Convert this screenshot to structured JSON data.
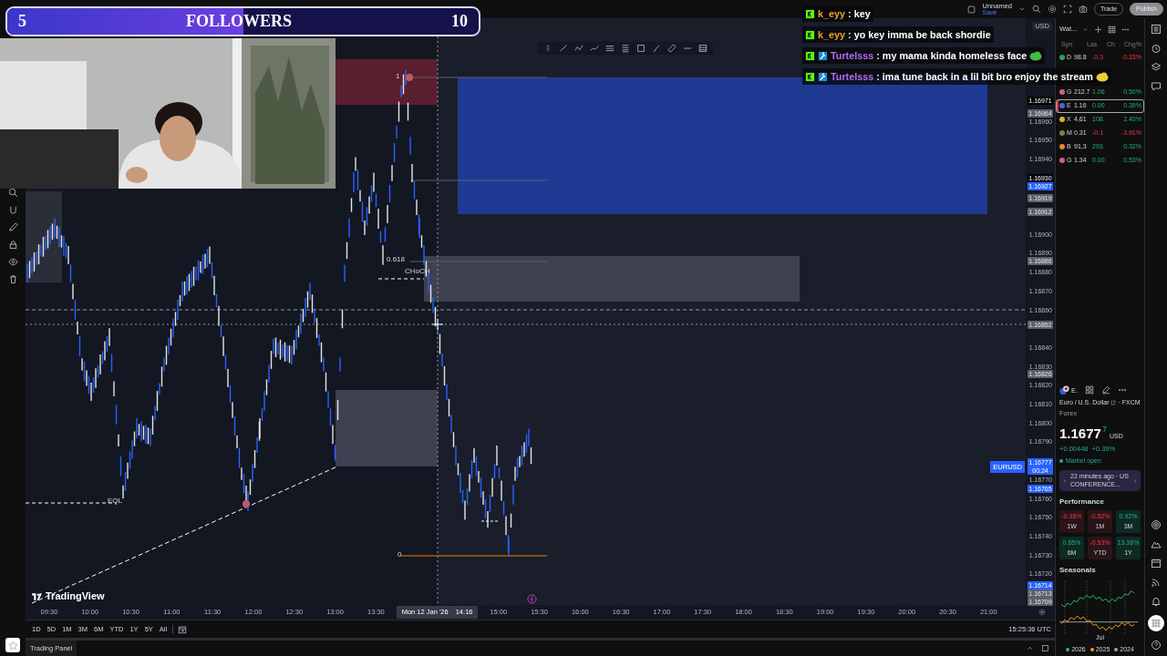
{
  "stream_overlay": {
    "followers": {
      "current": "5",
      "label": "FOLLOWERS",
      "goal": "10",
      "level": 0.5
    },
    "chat": [
      {
        "badges": [
          {
            "kind": "kick"
          }
        ],
        "user": "k_eyy",
        "color": "#f0a030",
        "message": ": key"
      },
      {
        "badges": [
          {
            "kind": "kick"
          }
        ],
        "user": "k_eyy",
        "color": "#f0a030",
        "message": ": yo key imma be back shordie"
      },
      {
        "badges": [
          {
            "kind": "kick"
          },
          {
            "kind": "hammer"
          }
        ],
        "user": "Turtelsss",
        "color": "#b36cf0",
        "message": ": my mama kinda homeless face",
        "emote": {
          "color": "#3fbf3f"
        }
      },
      {
        "badges": [
          {
            "kind": "kick"
          },
          {
            "kind": "hammer"
          }
        ],
        "user": "Turtelsss",
        "color": "#b36cf0",
        "message": ": ima tune back in a lil bit bro enjoy the stream",
        "emote": {
          "color": "#e8d030"
        }
      }
    ]
  },
  "top_bar": {
    "layout_name": "Unnamed",
    "layout_status": "Save",
    "trade": "Trade",
    "publish": "Publish"
  },
  "chart": {
    "symbol_tag": "EURUSD",
    "logo": "TradingView",
    "labels": [
      "1",
      "0.618",
      "CHoCH",
      "0",
      "EQL"
    ],
    "price_axis": {
      "currency": "USD",
      "ticks": [
        "1.16960",
        "1.16950",
        "1.16940",
        "1.16900",
        "1.16890",
        "1.16880",
        "1.16870",
        "1.16860",
        "1.16840",
        "1.16830",
        "1.16820",
        "1.16810",
        "1.16800",
        "1.16790",
        "1.16770",
        "1.16760",
        "1.16750",
        "1.16740",
        "1.16730",
        "1.16720"
      ],
      "tags": [
        {
          "value": "1.16971",
          "kind": "dark"
        },
        {
          "value": "1.16964",
          "kind": "gray"
        },
        {
          "value": "1.16930",
          "kind": "dark"
        },
        {
          "value": "1.16927",
          "kind": "blue"
        },
        {
          "value": "1.16919",
          "kind": "gray"
        },
        {
          "value": "1.16912",
          "kind": "gray"
        },
        {
          "value": "1.16886",
          "kind": "gray"
        },
        {
          "value": "1.16852",
          "kind": "gray"
        },
        {
          "value": "1.16826",
          "kind": "gray"
        },
        {
          "value": "1.16777",
          "kind": "blue",
          "countdown": "00:24"
        },
        {
          "value": "1.16765",
          "kind": "blue"
        },
        {
          "value": "1.16714",
          "kind": "blue"
        },
        {
          "value": "1.16713",
          "kind": "gray"
        },
        {
          "value": "1.16709",
          "kind": "gray"
        }
      ]
    },
    "time_axis": [
      {
        "label": "09:30"
      },
      {
        "label": "10:00"
      },
      {
        "label": "10:30"
      },
      {
        "label": "11:00"
      },
      {
        "label": "11:30"
      },
      {
        "label": "12:00"
      },
      {
        "label": "12:30"
      },
      {
        "label": "13:00"
      },
      {
        "label": "13:30"
      },
      {
        "kind": "crosshair",
        "label": "Mon 12 Jan '26",
        "time": "14:16"
      },
      {
        "label": "15:00"
      },
      {
        "label": "15:30"
      },
      {
        "label": "16:00"
      },
      {
        "label": "16:30"
      },
      {
        "label": "17:00"
      },
      {
        "label": "17:30"
      },
      {
        "label": "18:00"
      },
      {
        "label": "18:30"
      },
      {
        "label": "19:00"
      },
      {
        "label": "19:30"
      },
      {
        "label": "20:00"
      },
      {
        "label": "20:30"
      },
      {
        "label": "21:00"
      }
    ]
  },
  "range_buttons": [
    "1D",
    "5D",
    "1M",
    "3M",
    "6M",
    "YTD",
    "1Y",
    "5Y",
    "All"
  ],
  "clock": "15:25:36 UTC",
  "trading_panel": "Trading Panel",
  "watchlist": {
    "title": "Wat...",
    "columns": [
      "Syn",
      "Las",
      "Ch",
      "Chg%"
    ],
    "rows": [
      {
        "symbol": "D",
        "last": "98.8",
        "change": "-0.3",
        "change_pct": "-0.33%",
        "negative": true,
        "color": "#2e9e5b",
        "selected": false
      },
      {
        "symbol": "G",
        "last": "212.7",
        "change": "1.06",
        "change_pct": "0.50%",
        "negative": false,
        "color": "#d0607a",
        "selected": false
      },
      {
        "symbol": "E",
        "last": "1.16",
        "change": "0.00",
        "change_pct": "0.39%",
        "negative": false,
        "color": "#3a6fd8",
        "selected": true
      },
      {
        "symbol": "X",
        "last": "4,61",
        "change": "108.",
        "change_pct": "2.40%",
        "negative": false,
        "color": "#e0b030",
        "selected": false
      },
      {
        "symbol": "M",
        "last": "0.31",
        "change": "-0.1",
        "change_pct": "-3.91%",
        "negative": true,
        "color": "#8a7a3a",
        "selected": false
      },
      {
        "symbol": "B",
        "last": "91,3",
        "change": "293.",
        "change_pct": "0.32%",
        "negative": false,
        "color": "#e08a30",
        "selected": false
      },
      {
        "symbol": "G",
        "last": "1.34",
        "change": "0.00",
        "change_pct": "0.53%",
        "negative": false,
        "color": "#d06080",
        "selected": false
      }
    ]
  },
  "quote": {
    "symbol": "E.",
    "name": "Euro / U.S. Dollar",
    "exchange": "· FXCM",
    "type": "Forex",
    "price": "1.1677",
    "price_last_digit": "7",
    "currency": "USD",
    "change": "+0.00448",
    "change_pct": "+0.39%",
    "status": "Market open",
    "news": "22 minutes ago · US CONFERENCE...",
    "performance_title": "Performance",
    "performance": [
      {
        "value": "-0.38%",
        "period": "1W",
        "negative": true
      },
      {
        "value": "-0.52%",
        "period": "1M",
        "negative": true
      },
      {
        "value": "0.92%",
        "period": "3M",
        "negative": false
      },
      {
        "value": "0.65%",
        "period": "6M",
        "negative": false
      },
      {
        "value": "-0.53%",
        "period": "YTD",
        "negative": true
      },
      {
        "value": "13.38%",
        "period": "1Y",
        "negative": false
      }
    ],
    "seasonals_title": "Seasonals",
    "seasonals_month": "Jul",
    "seasonals_legend": [
      {
        "year": "2026",
        "color": "#22c55e"
      },
      {
        "year": "2025",
        "color": "#f59e0b"
      },
      {
        "year": "2024",
        "color": "#9ca3af"
      }
    ]
  }
}
